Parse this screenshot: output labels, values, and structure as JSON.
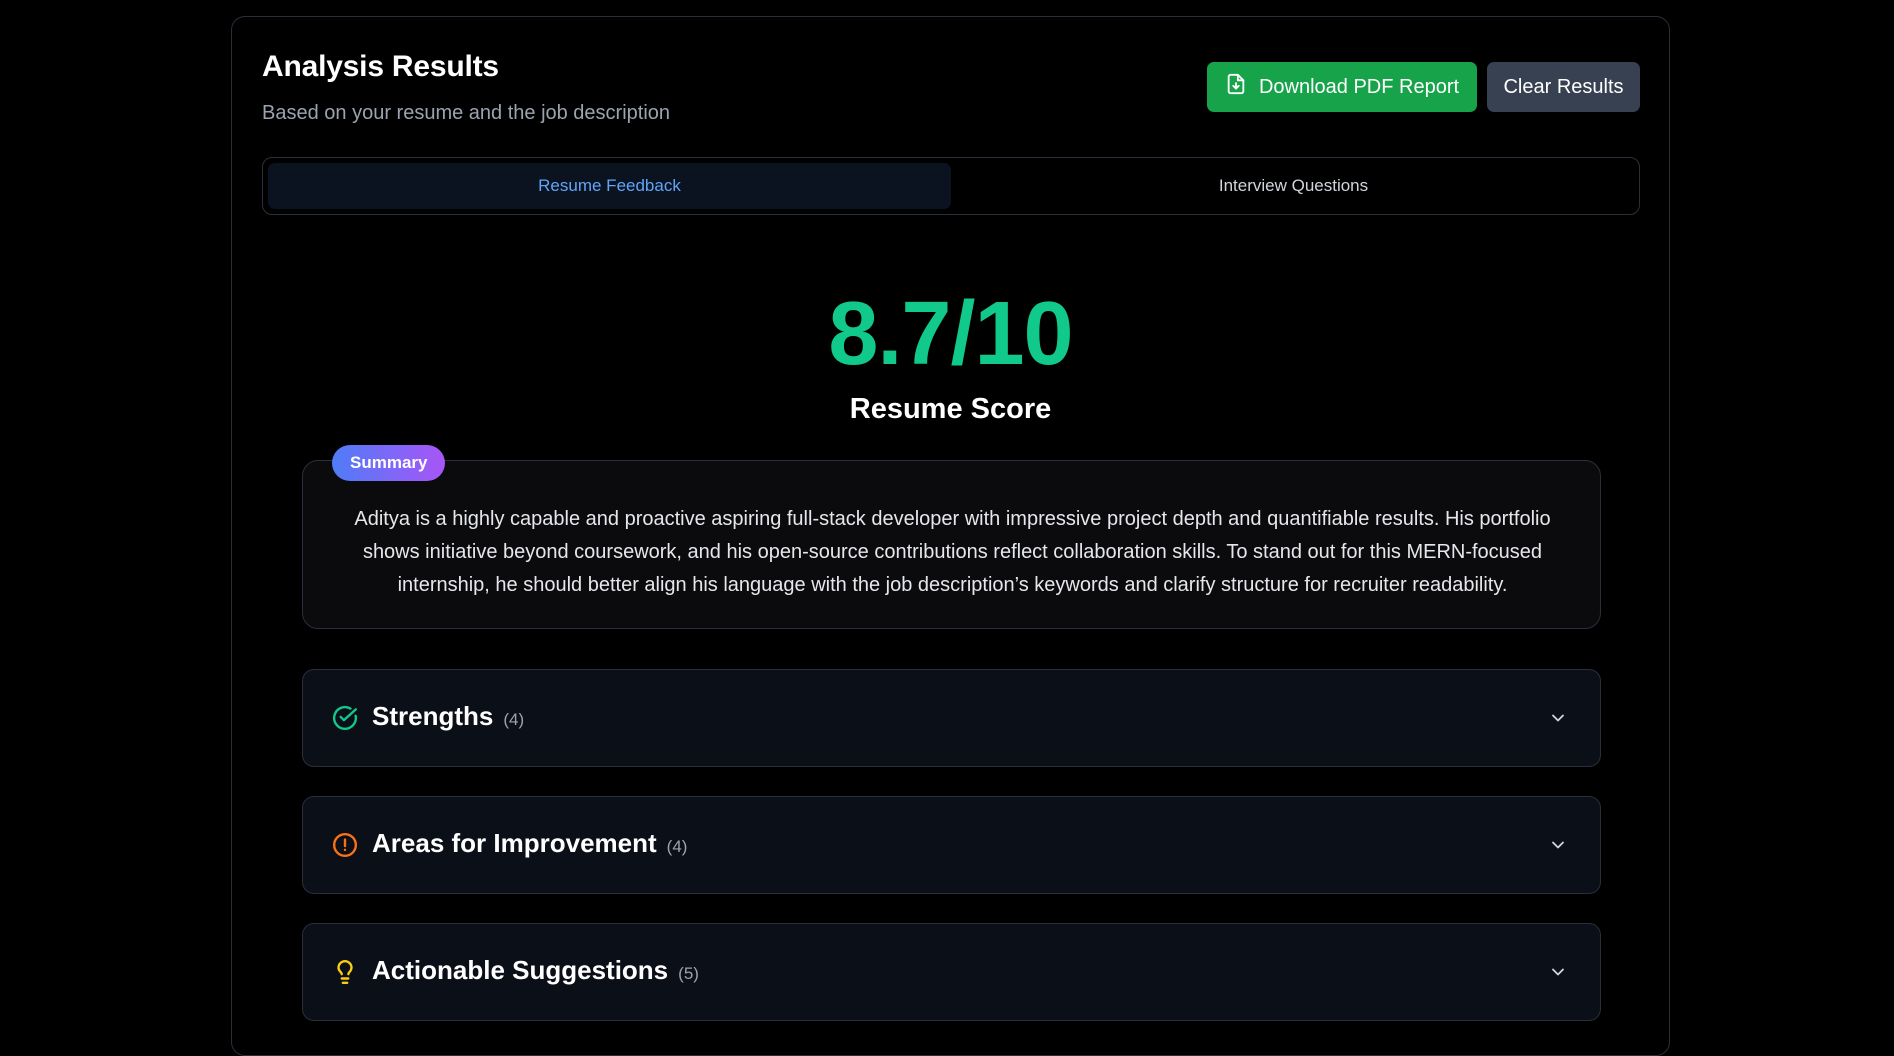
{
  "header": {
    "title": "Analysis Results",
    "subtitle": "Based on your resume and the job description"
  },
  "actions": {
    "download_label": "Download PDF Report",
    "clear_label": "Clear Results"
  },
  "tabs": [
    {
      "label": "Resume Feedback",
      "active": true
    },
    {
      "label": "Interview Questions",
      "active": false
    }
  ],
  "score": {
    "value": "8.7/10",
    "label": "Resume Score"
  },
  "summary": {
    "badge": "Summary",
    "text": "Aditya is a highly capable and proactive aspiring full-stack developer with impressive project depth and quantifiable results. His portfolio shows initiative beyond coursework, and his open-source contributions reflect collaboration skills. To stand out for this MERN-focused internship, he should better align his language with the job description’s keywords and clarify structure for recruiter readability."
  },
  "sections": [
    {
      "title": "Strengths",
      "count": "(4)",
      "icon": "check-circle-icon",
      "color": "#10c98a"
    },
    {
      "title": "Areas for Improvement",
      "count": "(4)",
      "icon": "alert-circle-icon",
      "color": "#f97316"
    },
    {
      "title": "Actionable Suggestions",
      "count": "(5)",
      "icon": "lightbulb-icon",
      "color": "#facc15"
    }
  ],
  "colors": {
    "accent_green": "#16a34a",
    "score_green": "#10c98a",
    "tab_active": "#60a5fa"
  }
}
